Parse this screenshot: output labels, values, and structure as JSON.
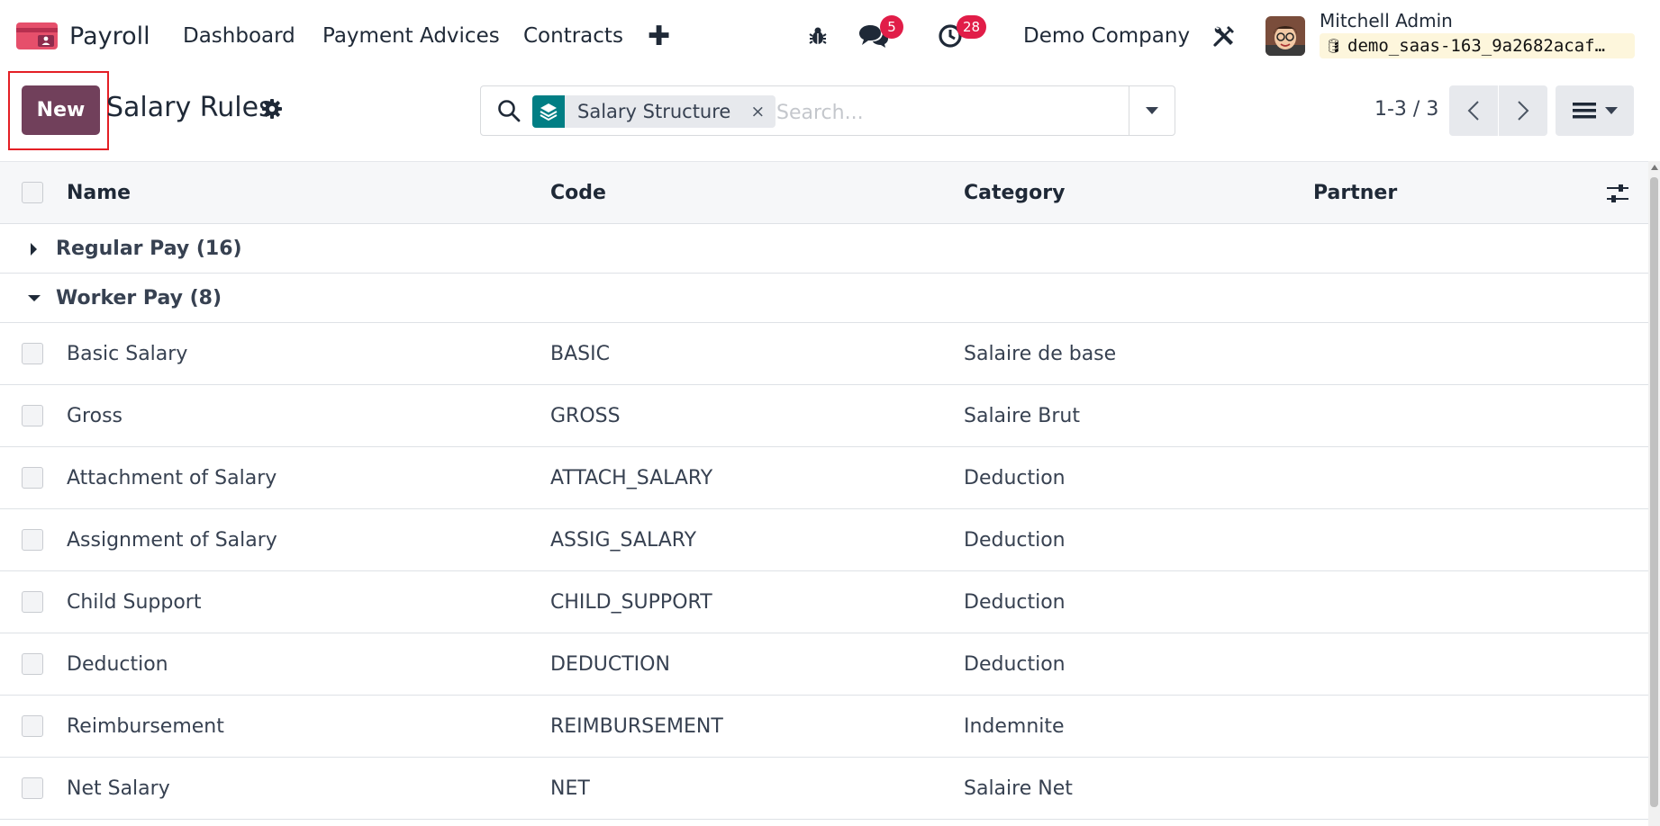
{
  "navbar": {
    "app_name": "Payroll",
    "menu": [
      "Dashboard",
      "Payment Advices",
      "Contracts"
    ],
    "messages_count": "5",
    "activities_count": "28",
    "company": "Demo Company",
    "user_name": "Mitchell Admin",
    "database": "demo_saas-163_9a2682acaf…"
  },
  "control_panel": {
    "new_label": "New",
    "title": "Salary Rules",
    "search": {
      "facet_label": "Salary Structure",
      "facet_remove": "×",
      "placeholder": "Search..."
    },
    "pager": "1-3 / 3"
  },
  "table": {
    "columns": [
      "Name",
      "Code",
      "Category",
      "Partner"
    ],
    "groups": [
      {
        "label": "Regular Pay (16)",
        "expanded": false
      },
      {
        "label": "Worker Pay (8)",
        "expanded": true
      }
    ],
    "rows": [
      {
        "name": "Basic Salary",
        "code": "BASIC",
        "category": "Salaire de base",
        "partner": ""
      },
      {
        "name": "Gross",
        "code": "GROSS",
        "category": "Salaire Brut",
        "partner": ""
      },
      {
        "name": "Attachment of Salary",
        "code": "ATTACH_SALARY",
        "category": "Deduction",
        "partner": ""
      },
      {
        "name": "Assignment of Salary",
        "code": "ASSIG_SALARY",
        "category": "Deduction",
        "partner": ""
      },
      {
        "name": "Child Support",
        "code": "CHILD_SUPPORT",
        "category": "Deduction",
        "partner": ""
      },
      {
        "name": "Deduction",
        "code": "DEDUCTION",
        "category": "Deduction",
        "partner": ""
      },
      {
        "name": "Reimbursement",
        "code": "REIMBURSEMENT",
        "category": "Indemnite",
        "partner": ""
      },
      {
        "name": "Net Salary",
        "code": "NET",
        "category": "Salaire Net",
        "partner": ""
      }
    ]
  },
  "icons": {
    "app_logo": "payroll-logo-icon",
    "bug": "bug-icon",
    "chat": "chat-icon",
    "clock": "activity-clock-icon",
    "tools": "tools-icon",
    "gear": "gear-icon",
    "search": "search-icon",
    "facet": "layers-icon",
    "column_settings": "sliders-icon"
  },
  "colors": {
    "primary": "#71405b",
    "badge": "#e11d48",
    "facet": "#017e84",
    "highlight": "#e41f25"
  }
}
